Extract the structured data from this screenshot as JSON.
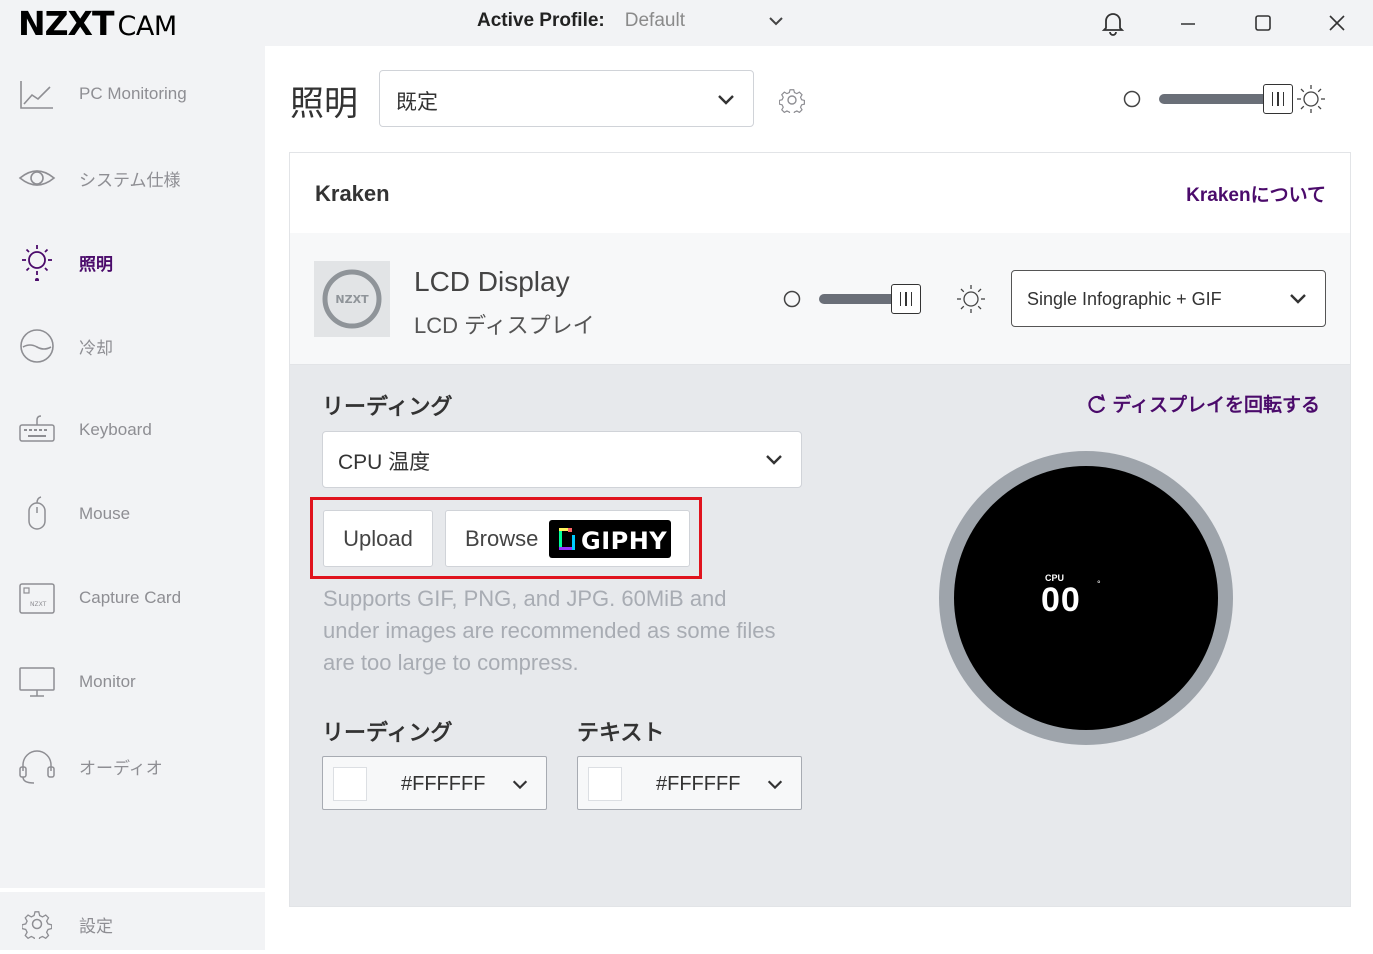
{
  "app": {
    "brand": "NZXT",
    "product": "CAM",
    "profile_label": "Active Profile:",
    "profile_value": "Default"
  },
  "sidebar": {
    "items": [
      {
        "label": "PC Monitoring",
        "icon": "chart-line-icon"
      },
      {
        "label": "システム仕様",
        "icon": "eye-icon"
      },
      {
        "label": "照明",
        "icon": "sun-icon",
        "active": true
      },
      {
        "label": "冷却",
        "icon": "cooling-icon"
      },
      {
        "label": "Keyboard",
        "icon": "keyboard-icon"
      },
      {
        "label": "Mouse",
        "icon": "mouse-icon"
      },
      {
        "label": "Capture Card",
        "icon": "capture-card-icon"
      },
      {
        "label": "Monitor",
        "icon": "monitor-icon"
      },
      {
        "label": "オーディオ",
        "icon": "headset-icon"
      }
    ],
    "settings_label": "設定"
  },
  "main": {
    "title": "照明",
    "preset_value": "既定",
    "global_brightness": 1.0
  },
  "panel": {
    "title": "Kraken",
    "about_link": "Krakenについて",
    "device": {
      "thumb_text": "NZXT",
      "name": "LCD Display",
      "subtitle": "LCD ディスプレイ",
      "brightness": 1.0,
      "mode_value": "Single Infographic + GIF"
    },
    "reading_label": "リーディング",
    "reading_value": "CPU 温度",
    "upload_label": "Upload",
    "browse_label": "Browse",
    "giphy_label": "GIPHY",
    "help_text": "Supports GIF, PNG, and JPG. 60MiB and under images are recommended as some files are too large to compress.",
    "reading_color_label": "リーディング",
    "reading_color_value": "#FFFFFF",
    "text_color_label": "テキスト",
    "text_color_value": "#FFFFFF",
    "rotate_link": "ディスプレイを回転する",
    "preview": {
      "metric": "CPU",
      "value": "00",
      "unit": "°"
    }
  },
  "colors": {
    "accent": "#4b0b6b",
    "highlight": "#e0131d",
    "sidebar_bg": "#f2f3f5"
  }
}
